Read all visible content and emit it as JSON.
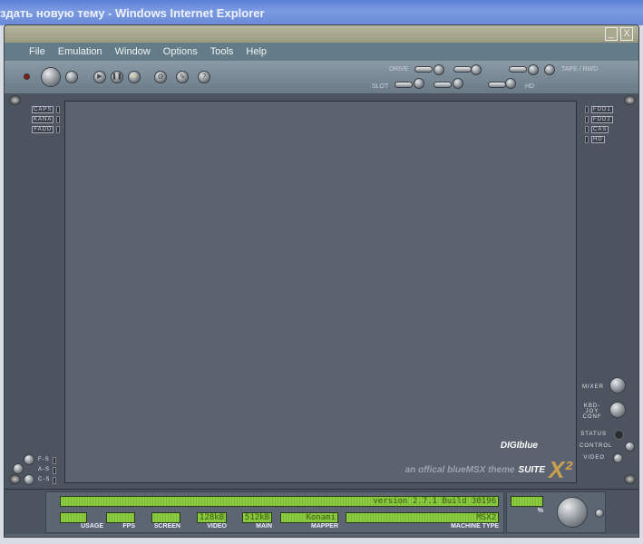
{
  "ie": {
    "title": "здать новую тему - Windows Internet Explorer"
  },
  "window": {
    "min": "_",
    "close": "X"
  },
  "menu": [
    "File",
    "Emulation",
    "Window",
    "Options",
    "Tools",
    "Help"
  ],
  "toolbar": {
    "drive": "DRIVE",
    "slot": "SLOT",
    "tape": "TAPE / RWD",
    "hd": "HD"
  },
  "left_leds": [
    "CAPS",
    "KANA",
    "FADD"
  ],
  "left_bottom": [
    "F-S",
    "A-S",
    "C-S"
  ],
  "right_leds": [
    "FDD1",
    "FDD2",
    "CAS",
    "HD"
  ],
  "right_controls": {
    "mixer": "MIXER",
    "kbd": "KBD- JOY CONF",
    "status": "STATUS",
    "control": "CONTROL",
    "video": "VIDEO"
  },
  "logo": {
    "brand": "DIGIblue",
    "suite": "SUITE",
    "tagline": "an offical blueMSX theme"
  },
  "statusbar": {
    "version": "version 2.7.1  Build 30196",
    "fields": [
      {
        "label": "USAGE",
        "value": ""
      },
      {
        "label": "FPS",
        "value": ""
      },
      {
        "label": "SCREEN",
        "value": ""
      },
      {
        "label": "VIDEO",
        "value": "128kB"
      },
      {
        "label": "MAIN",
        "value": "512kB"
      },
      {
        "label": "MAPPER",
        "value": "Konami"
      },
      {
        "label": "MACHINE TYPE",
        "value": "MSX2"
      }
    ],
    "percent_label": "%",
    "percent_value": ""
  }
}
